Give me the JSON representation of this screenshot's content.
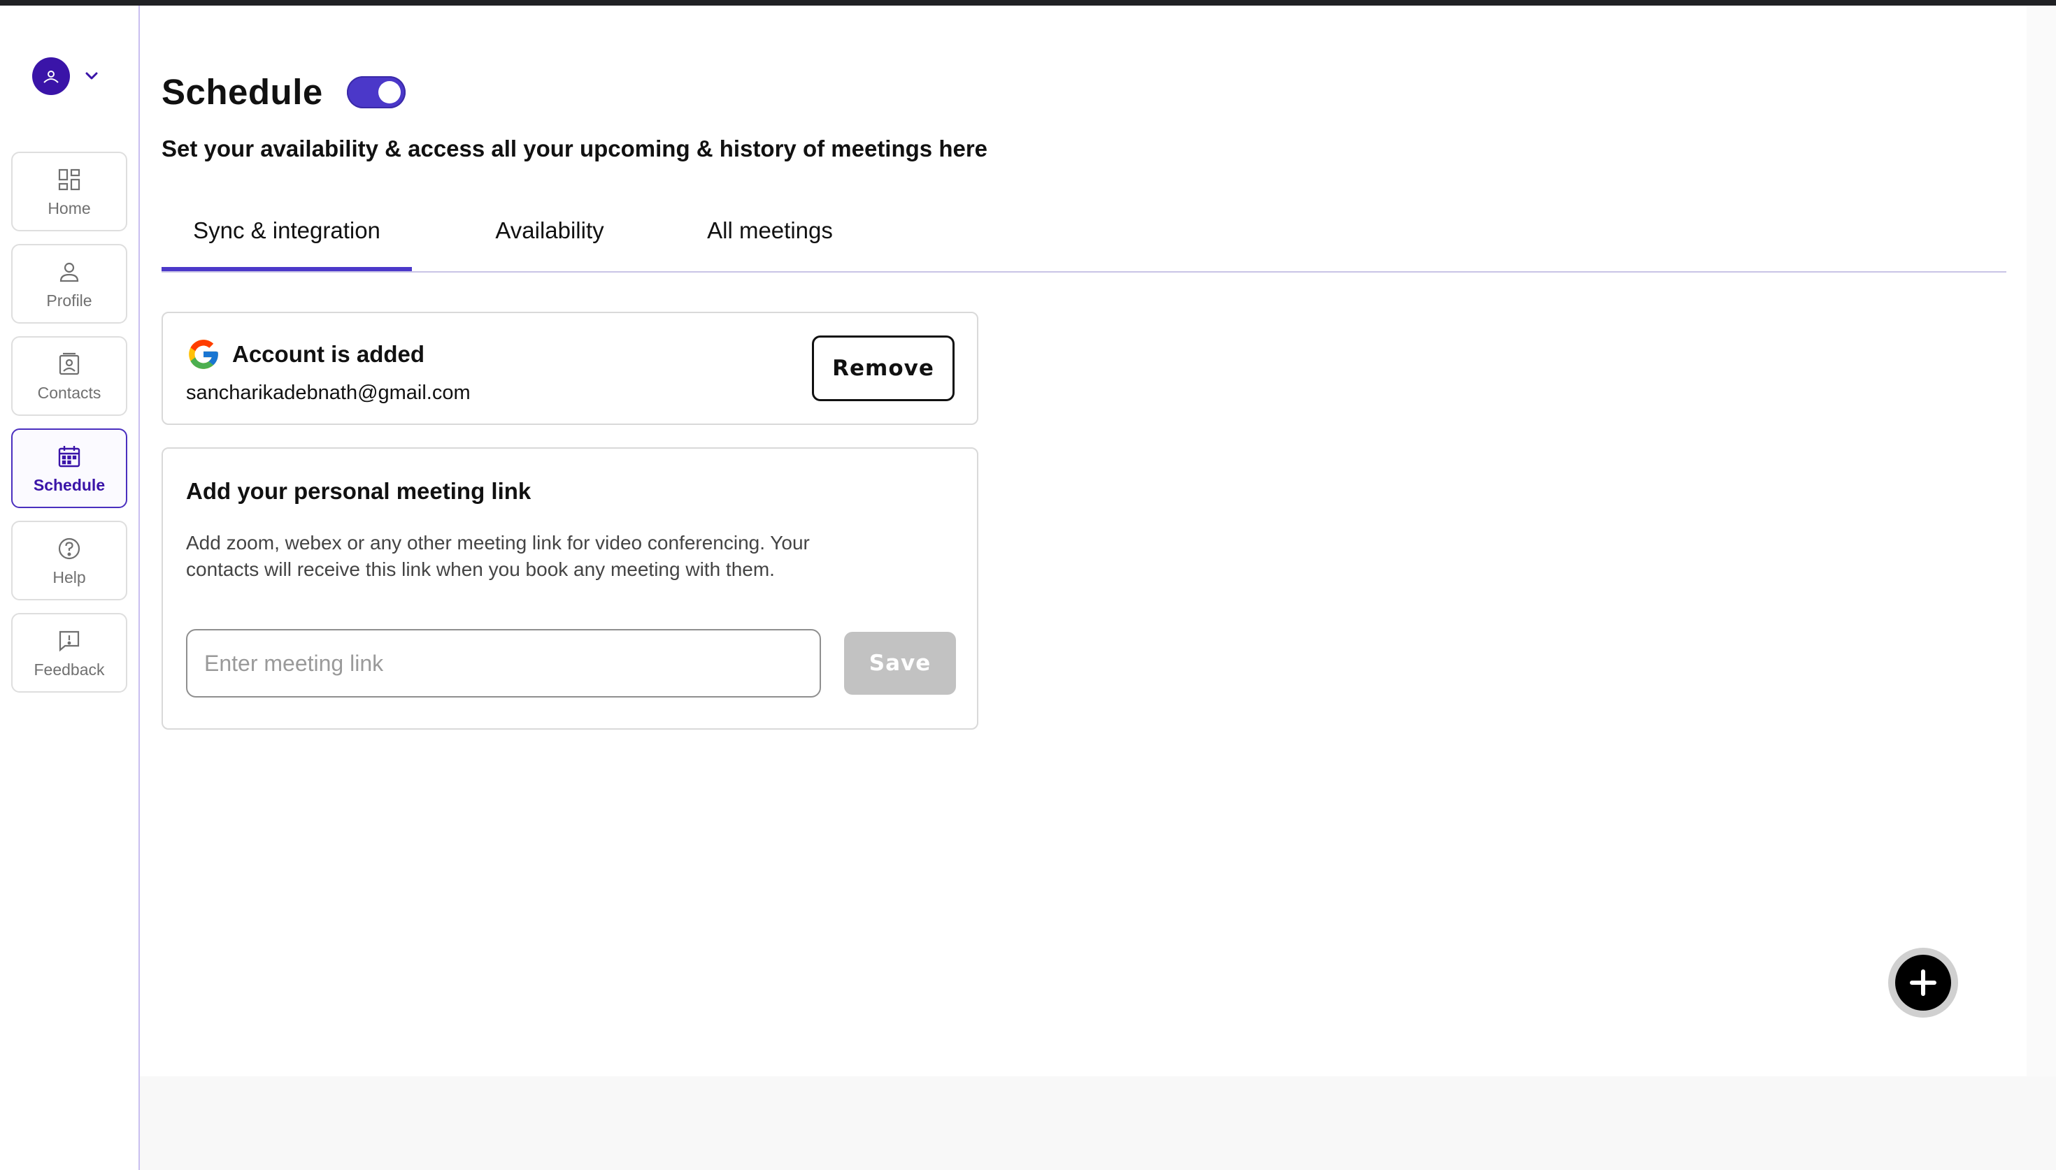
{
  "colors": {
    "accent": "#4b38c9",
    "avatar": "#3a14a8",
    "save_disabled": "#c2c2c2"
  },
  "account_menu": {
    "avatar_icon": "user-avatar-icon",
    "chevron_icon": "chevron-down-icon"
  },
  "sidebar": {
    "items": [
      {
        "label": "Home",
        "icon": "dashboard-grid-icon",
        "active": false
      },
      {
        "label": "Profile",
        "icon": "person-icon",
        "active": false
      },
      {
        "label": "Contacts",
        "icon": "contact-card-icon",
        "active": false
      },
      {
        "label": "Schedule",
        "icon": "calendar-icon",
        "active": true
      },
      {
        "label": "Help",
        "icon": "question-circle-icon",
        "active": false
      },
      {
        "label": "Feedback",
        "icon": "feedback-bubble-icon",
        "active": false
      }
    ]
  },
  "header": {
    "title": "Schedule",
    "toggle_on": true,
    "subtitle": "Set your availability & access all your upcoming & history of meetings here"
  },
  "tabs": [
    {
      "label": "Sync & integration",
      "active": true
    },
    {
      "label": "Availability",
      "active": false
    },
    {
      "label": "All meetings",
      "active": false
    }
  ],
  "account_card": {
    "icon": "google-icon",
    "title": "Account is added",
    "email": "sancharikadebnath@gmail.com",
    "remove_label": "Remove"
  },
  "meeting_link_card": {
    "title": "Add your personal meeting link",
    "description": "Add zoom, webex or any other meeting link for video conferencing. Your contacts will receive this link when you book any meeting with them.",
    "input_value": "",
    "input_placeholder": "Enter meeting link",
    "save_label": "Save"
  },
  "fab": {
    "icon": "plus-icon"
  }
}
